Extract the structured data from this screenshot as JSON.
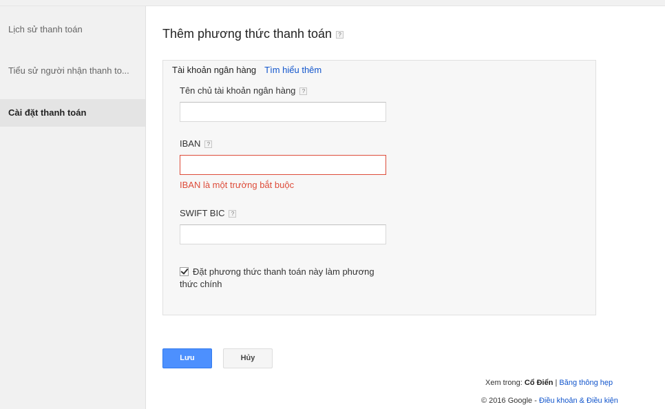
{
  "sidebar": {
    "items": [
      {
        "label": "Lịch sử thanh toán"
      },
      {
        "label": "Tiểu sử người nhận thanh to..."
      },
      {
        "label": "Cài đặt thanh toán"
      }
    ]
  },
  "main": {
    "title": "Thêm phương thức thanh toán",
    "help_glyph": "?",
    "panel": {
      "heading": "Tài khoản ngân hàng",
      "learn_more": "Tìm hiểu thêm",
      "fields": {
        "holder": {
          "label": "Tên chủ tài khoản ngân hàng",
          "value": ""
        },
        "iban": {
          "label": "IBAN",
          "value": "",
          "error": "IBAN là một trường bắt buộc"
        },
        "swift": {
          "label": "SWIFT BIC",
          "value": ""
        }
      },
      "primary_checkbox": {
        "label": "Đặt phương thức thanh toán này làm phương thức chính",
        "checked": true
      }
    },
    "buttons": {
      "save": "Lưu",
      "cancel": "Hủy"
    }
  },
  "footer": {
    "view_in_prefix": "Xem trong:",
    "view_classic": "Cổ Điển",
    "separator": "|",
    "view_narrow": "Băng thông hẹp",
    "copyright": "© 2016 Google -",
    "terms": "Điều khoản & Điều kiện"
  },
  "colors": {
    "accent": "#4d90fe",
    "link": "#1155cc",
    "error": "#dd4b39"
  }
}
